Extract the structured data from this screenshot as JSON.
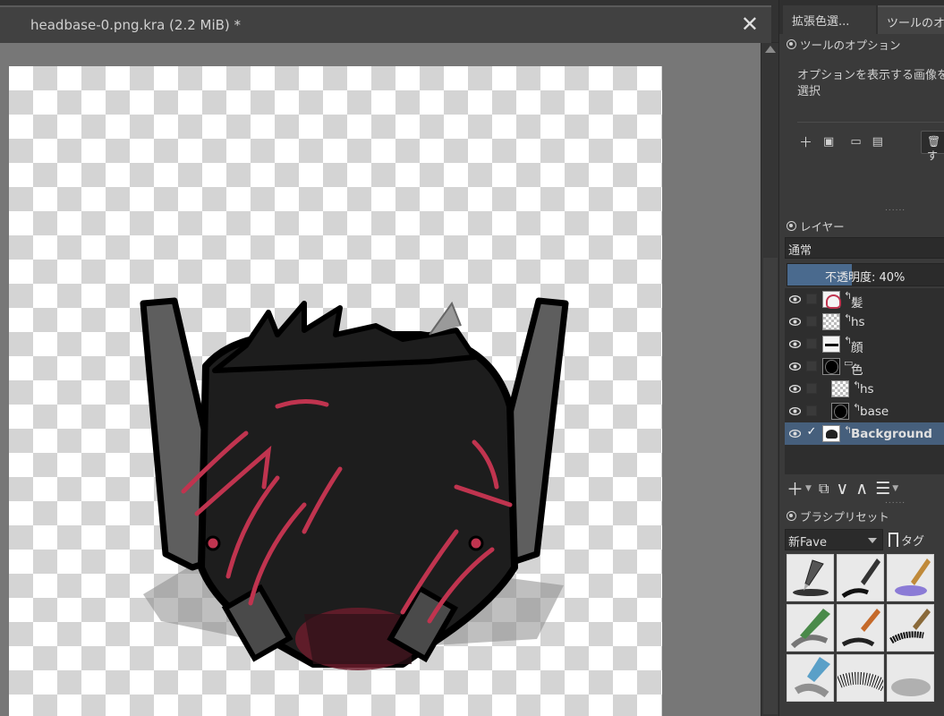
{
  "document_tab": {
    "title": "headbase-0.png.kra (2.2 MiB) *",
    "close_label": "✕"
  },
  "docker_tabs": [
    "拡張色選...",
    "ツールのオ"
  ],
  "tool_options": {
    "title": "ツールのオプション",
    "message": "オプションを表示する画像を選択",
    "delete_label": "す"
  },
  "layers_panel": {
    "title": "レイヤー",
    "blend_mode": "通常",
    "opacity_label": "不透明度: 40%",
    "opacity_value": 0.4,
    "layers": [
      {
        "name": "髪",
        "type": "paint",
        "thumb": "hair",
        "indent": 0,
        "visible": true,
        "checked": false,
        "selected": false
      },
      {
        "name": "hs",
        "type": "paint",
        "thumb": "light",
        "indent": 0,
        "visible": true,
        "checked": false,
        "selected": false
      },
      {
        "name": "顔",
        "type": "paint",
        "thumb": "line",
        "indent": 0,
        "visible": true,
        "checked": false,
        "selected": false
      },
      {
        "name": "色",
        "type": "group",
        "thumb": "dark",
        "indent": 0,
        "visible": true,
        "checked": false,
        "selected": false
      },
      {
        "name": "hs",
        "type": "paint",
        "thumb": "light",
        "indent": 1,
        "visible": true,
        "checked": false,
        "selected": false
      },
      {
        "name": "base",
        "type": "paint",
        "thumb": "dark",
        "indent": 1,
        "visible": true,
        "checked": false,
        "selected": false
      },
      {
        "name": "Background",
        "type": "paint",
        "thumb": "bg",
        "indent": 0,
        "visible": true,
        "checked": true,
        "selected": true
      }
    ]
  },
  "brush_presets": {
    "title": "ブラシプリセット",
    "tag_selected": "新Fave",
    "tag_button": "タグ"
  },
  "colors": {
    "accent_selected": "#465f7c",
    "opacity_fill": "#4a6a8e",
    "hair_highlight": "#c0344f"
  }
}
